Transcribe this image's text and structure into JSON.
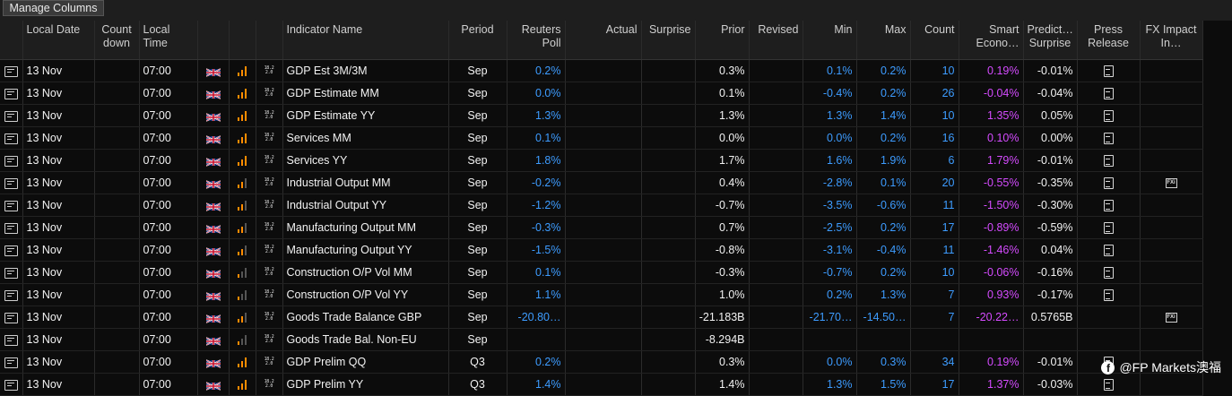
{
  "toolbar": {
    "manage_columns_label": "Manage Columns"
  },
  "columns": {
    "local_date": "Local Date",
    "countdown": "Count down",
    "local_time": "Local Time",
    "indicator_name": "Indicator Name",
    "period": "Period",
    "reuters_poll": "Reuters Poll",
    "actual": "Actual",
    "surprise": "Surprise",
    "prior": "Prior",
    "revised": "Revised",
    "min": "Min",
    "max": "Max",
    "count": "Count",
    "smart_econ": "Smart Econo…",
    "predict_surprise": "Predict… Surprise",
    "press_release": "Press Release",
    "fx_impact": "FX Impact In…"
  },
  "icons": {
    "row": "calendar-event-icon",
    "country": "uk-flag-icon",
    "importance": "importance-bars-icon",
    "calendar": "calendar-date-icon",
    "press_release": "document-icon",
    "fx_impact": "fx-impact-icon"
  },
  "colors": {
    "poll": "#3d9cff",
    "smart": "#d54bff",
    "importance_on": "#ff8c00",
    "importance_off": "#555555"
  },
  "rows": [
    {
      "date": "13 Nov",
      "time": "07:00",
      "importance": 3,
      "name": "GDP Est 3M/3M",
      "period": "Sep",
      "poll": "0.2%",
      "actual": "",
      "surprise": "",
      "prior": "0.3%",
      "revised": "",
      "min": "0.1%",
      "max": "0.2%",
      "count": "10",
      "smart": "0.19%",
      "predict": "-0.01%",
      "press": true,
      "fx": false
    },
    {
      "date": "13 Nov",
      "time": "07:00",
      "importance": 3,
      "name": "GDP Estimate MM",
      "period": "Sep",
      "poll": "0.0%",
      "actual": "",
      "surprise": "",
      "prior": "0.1%",
      "revised": "",
      "min": "-0.4%",
      "max": "0.2%",
      "count": "26",
      "smart": "-0.04%",
      "predict": "-0.04%",
      "press": true,
      "fx": false
    },
    {
      "date": "13 Nov",
      "time": "07:00",
      "importance": 3,
      "name": "GDP Estimate YY",
      "period": "Sep",
      "poll": "1.3%",
      "actual": "",
      "surprise": "",
      "prior": "1.3%",
      "revised": "",
      "min": "1.3%",
      "max": "1.4%",
      "count": "10",
      "smart": "1.35%",
      "predict": "0.05%",
      "press": true,
      "fx": false
    },
    {
      "date": "13 Nov",
      "time": "07:00",
      "importance": 3,
      "name": "Services MM",
      "period": "Sep",
      "poll": "0.1%",
      "actual": "",
      "surprise": "",
      "prior": "0.0%",
      "revised": "",
      "min": "0.0%",
      "max": "0.2%",
      "count": "16",
      "smart": "0.10%",
      "predict": "0.00%",
      "press": true,
      "fx": false
    },
    {
      "date": "13 Nov",
      "time": "07:00",
      "importance": 3,
      "name": "Services YY",
      "period": "Sep",
      "poll": "1.8%",
      "actual": "",
      "surprise": "",
      "prior": "1.7%",
      "revised": "",
      "min": "1.6%",
      "max": "1.9%",
      "count": "6",
      "smart": "1.79%",
      "predict": "-0.01%",
      "press": true,
      "fx": false
    },
    {
      "date": "13 Nov",
      "time": "07:00",
      "importance": 2,
      "name": "Industrial Output MM",
      "period": "Sep",
      "poll": "-0.2%",
      "actual": "",
      "surprise": "",
      "prior": "0.4%",
      "revised": "",
      "min": "-2.8%",
      "max": "0.1%",
      "count": "20",
      "smart": "-0.55%",
      "predict": "-0.35%",
      "press": true,
      "fx": true
    },
    {
      "date": "13 Nov",
      "time": "07:00",
      "importance": 2,
      "name": "Industrial Output YY",
      "period": "Sep",
      "poll": "-1.2%",
      "actual": "",
      "surprise": "",
      "prior": "-0.7%",
      "revised": "",
      "min": "-3.5%",
      "max": "-0.6%",
      "count": "11",
      "smart": "-1.50%",
      "predict": "-0.30%",
      "press": true,
      "fx": false
    },
    {
      "date": "13 Nov",
      "time": "07:00",
      "importance": 2,
      "name": "Manufacturing Output MM",
      "period": "Sep",
      "poll": "-0.3%",
      "actual": "",
      "surprise": "",
      "prior": "0.7%",
      "revised": "",
      "min": "-2.5%",
      "max": "0.2%",
      "count": "17",
      "smart": "-0.89%",
      "predict": "-0.59%",
      "press": true,
      "fx": false
    },
    {
      "date": "13 Nov",
      "time": "07:00",
      "importance": 2,
      "name": "Manufacturing Output YY",
      "period": "Sep",
      "poll": "-1.5%",
      "actual": "",
      "surprise": "",
      "prior": "-0.8%",
      "revised": "",
      "min": "-3.1%",
      "max": "-0.4%",
      "count": "11",
      "smart": "-1.46%",
      "predict": "0.04%",
      "press": true,
      "fx": false
    },
    {
      "date": "13 Nov",
      "time": "07:00",
      "importance": 1,
      "name": "Construction O/P Vol MM",
      "period": "Sep",
      "poll": "0.1%",
      "actual": "",
      "surprise": "",
      "prior": "-0.3%",
      "revised": "",
      "min": "-0.7%",
      "max": "0.2%",
      "count": "10",
      "smart": "-0.06%",
      "predict": "-0.16%",
      "press": true,
      "fx": false
    },
    {
      "date": "13 Nov",
      "time": "07:00",
      "importance": 1,
      "name": "Construction O/P Vol YY",
      "period": "Sep",
      "poll": "1.1%",
      "actual": "",
      "surprise": "",
      "prior": "1.0%",
      "revised": "",
      "min": "0.2%",
      "max": "1.3%",
      "count": "7",
      "smart": "0.93%",
      "predict": "-0.17%",
      "press": true,
      "fx": false
    },
    {
      "date": "13 Nov",
      "time": "07:00",
      "importance": 2,
      "name": "Goods Trade Balance GBP",
      "period": "Sep",
      "poll": "-20.80…",
      "actual": "",
      "surprise": "",
      "prior": "-21.183B",
      "revised": "",
      "min": "-21.70…",
      "max": "-14.50…",
      "count": "7",
      "smart": "-20.22…",
      "predict": "0.5765B",
      "press": false,
      "fx": true
    },
    {
      "date": "13 Nov",
      "time": "07:00",
      "importance": 1,
      "name": "Goods Trade Bal. Non-EU",
      "period": "Sep",
      "poll": "",
      "actual": "",
      "surprise": "",
      "prior": "-8.294B",
      "revised": "",
      "min": "",
      "max": "",
      "count": "",
      "smart": "",
      "predict": "",
      "press": false,
      "fx": false
    },
    {
      "date": "13 Nov",
      "time": "07:00",
      "importance": 3,
      "name": "GDP Prelim QQ",
      "period": "Q3",
      "poll": "0.2%",
      "actual": "",
      "surprise": "",
      "prior": "0.3%",
      "revised": "",
      "min": "0.0%",
      "max": "0.3%",
      "count": "34",
      "smart": "0.19%",
      "predict": "-0.01%",
      "press": true,
      "fx": false
    },
    {
      "date": "13 Nov",
      "time": "07:00",
      "importance": 3,
      "name": "GDP Prelim YY",
      "period": "Q3",
      "poll": "1.4%",
      "actual": "",
      "surprise": "",
      "prior": "1.4%",
      "revised": "",
      "min": "1.3%",
      "max": "1.5%",
      "count": "17",
      "smart": "1.37%",
      "predict": "-0.03%",
      "press": true,
      "fx": false
    }
  ],
  "watermark": {
    "icon": "facebook-icon",
    "text": "@FP Markets澳福"
  }
}
